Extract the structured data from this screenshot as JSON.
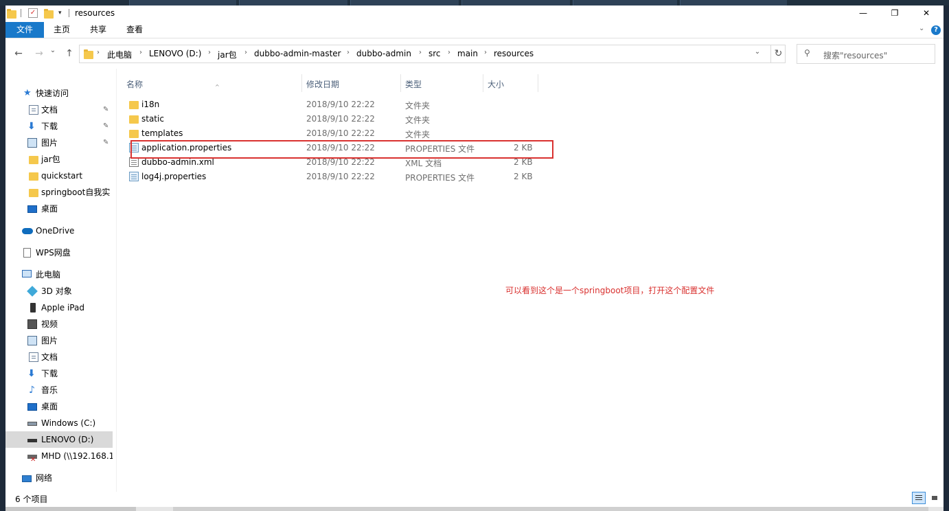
{
  "window": {
    "title": "resources",
    "minimize": "—",
    "restore": "❐",
    "close": "✕"
  },
  "ribbon": {
    "tabs": [
      "文件",
      "主页",
      "共享",
      "查看"
    ],
    "help": "?"
  },
  "nav": {
    "back": "←",
    "forward": "→",
    "recent": "⌄",
    "up": "↑",
    "breadcrumb": [
      "此电脑",
      "LENOVO (D:)",
      "jar包",
      "dubbo-admin-master",
      "dubbo-admin",
      "src",
      "main",
      "resources"
    ],
    "refresh": "↻",
    "search_placeholder": "搜索\"resources\""
  },
  "sidebar": {
    "items": [
      {
        "label": "快速访问",
        "icon": "star-icon",
        "pinned": false
      },
      {
        "label": "文档",
        "icon": "document-icon",
        "pinned": true
      },
      {
        "label": "下载",
        "icon": "download-icon",
        "pinned": true
      },
      {
        "label": "图片",
        "icon": "picture-icon",
        "pinned": true
      },
      {
        "label": "jar包",
        "icon": "folder-icon",
        "pinned": false
      },
      {
        "label": "quickstart",
        "icon": "folder-icon",
        "pinned": false
      },
      {
        "label": "springboot自我实",
        "icon": "folder-icon",
        "pinned": false
      },
      {
        "label": "桌面",
        "icon": "desktop-icon",
        "pinned": false
      },
      {
        "label": "OneDrive",
        "icon": "cloud-icon",
        "pinned": false
      },
      {
        "label": "WPS网盘",
        "icon": "wps-icon",
        "pinned": false
      },
      {
        "label": "此电脑",
        "icon": "computer-icon",
        "pinned": false
      },
      {
        "label": "3D 对象",
        "icon": "3d-objects-icon",
        "pinned": false
      },
      {
        "label": "Apple iPad",
        "icon": "tablet-icon",
        "pinned": false
      },
      {
        "label": "视频",
        "icon": "video-icon",
        "pinned": false
      },
      {
        "label": "图片",
        "icon": "picture-icon",
        "pinned": false
      },
      {
        "label": "文档",
        "icon": "document-icon",
        "pinned": false
      },
      {
        "label": "下载",
        "icon": "download-icon",
        "pinned": false
      },
      {
        "label": "音乐",
        "icon": "music-icon",
        "pinned": false
      },
      {
        "label": "桌面",
        "icon": "desktop-icon",
        "pinned": false
      },
      {
        "label": "Windows (C:)",
        "icon": "drive-icon",
        "pinned": false
      },
      {
        "label": "LENOVO (D:)",
        "icon": "drive-icon",
        "pinned": false,
        "selected": true
      },
      {
        "label": "MHD (\\\\192.168.1",
        "icon": "network-drive-icon",
        "pinned": false
      },
      {
        "label": "网络",
        "icon": "network-icon",
        "pinned": false
      }
    ],
    "pin_glyph": "📌"
  },
  "columns": {
    "name": "名称",
    "date": "修改日期",
    "type": "类型",
    "size": "大小"
  },
  "files": [
    {
      "name": "i18n",
      "date": "2018/9/10 22:22",
      "type": "文件夹",
      "size": "",
      "icon": "folder-icon"
    },
    {
      "name": "static",
      "date": "2018/9/10 22:22",
      "type": "文件夹",
      "size": "",
      "icon": "folder-icon"
    },
    {
      "name": "templates",
      "date": "2018/9/10 22:22",
      "type": "文件夹",
      "size": "",
      "icon": "folder-icon"
    },
    {
      "name": "application.properties",
      "date": "2018/9/10 22:22",
      "type": "PROPERTIES 文件",
      "size": "2 KB",
      "icon": "properties-file-icon"
    },
    {
      "name": "dubbo-admin.xml",
      "date": "2018/9/10 22:22",
      "type": "XML 文档",
      "size": "2 KB",
      "icon": "xml-file-icon"
    },
    {
      "name": "log4j.properties",
      "date": "2018/9/10 22:22",
      "type": "PROPERTIES 文件",
      "size": "2 KB",
      "icon": "properties-file-icon"
    }
  ],
  "annotation": "可以看到这个是一个springboot项目，打开这个配置文件",
  "status": {
    "item_count": "6 个项目"
  },
  "colors": {
    "accent": "#1979ca",
    "highlight": "#d9312f",
    "folder": "#f5c84c"
  }
}
